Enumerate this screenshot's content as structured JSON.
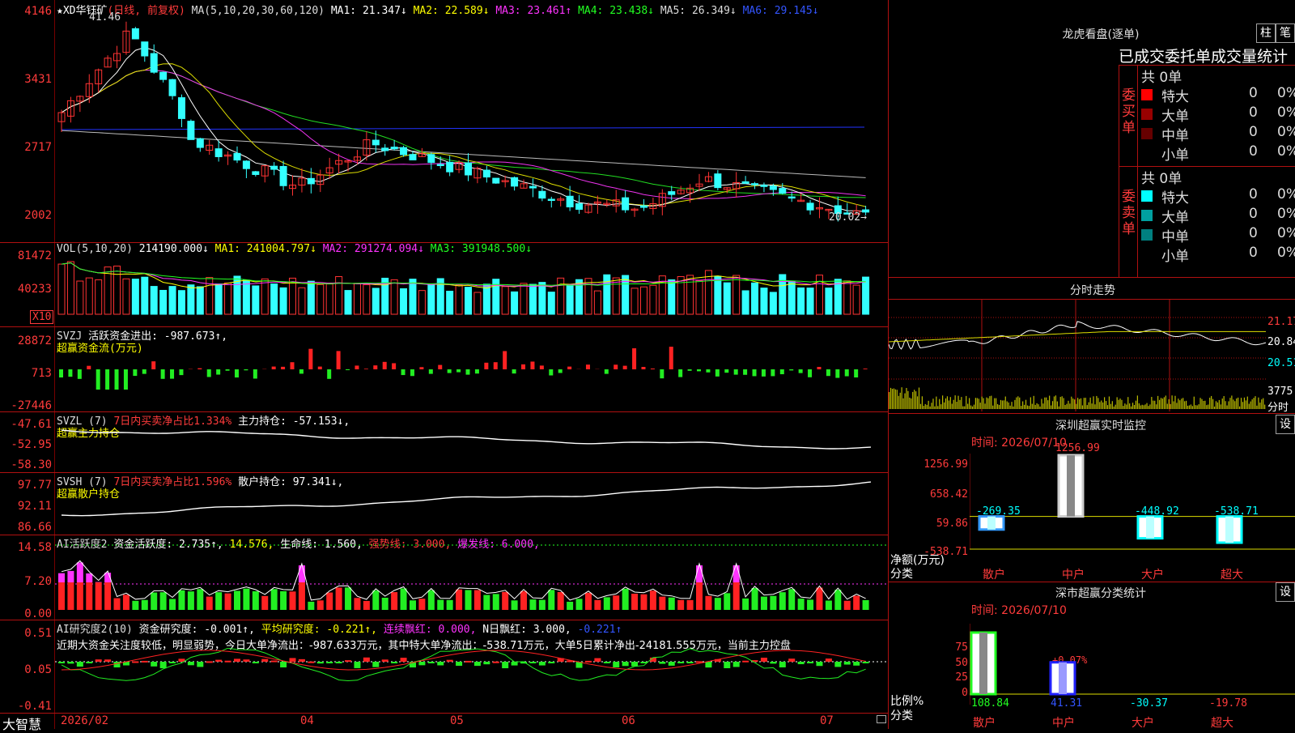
{
  "main_chart": {
    "stock_name": "★XD华钰矿",
    "period_tag": "(日线, 前复权)",
    "ma_header": "MA(5,10,20,30,60,120)",
    "ma1": "MA1: 21.347↓",
    "ma2": "MA2: 22.589↓",
    "ma3": "MA3: 23.461↑",
    "ma4": "MA4: 23.438↓",
    "ma5": "MA5: 26.349↓",
    "ma6": "MA6: 29.145↓",
    "high_label": "41.46",
    "low_label": "20.02→",
    "axis": [
      "4146",
      "3431",
      "2717",
      "2002"
    ]
  },
  "vol_panel": {
    "title": "VOL(5,10,20)",
    "value": "214190.000↓",
    "ma1": "MA1: 241004.797↓",
    "ma2": "MA2: 291274.094↓",
    "ma3": "MA3: 391948.500↓",
    "axis": [
      "81472",
      "40233"
    ],
    "unit": "X10"
  },
  "svzj_panel": {
    "title": "SVZJ",
    "line1": "活跃资金进出: -987.673↑,",
    "line2": "超赢资金流(万元)",
    "axis": [
      "28872",
      "713",
      "-27446"
    ]
  },
  "svzl_panel": {
    "title": "SVZL (7)",
    "ratio": "7日内买卖净占比1.334%",
    "main": "主力持仓: -57.153↓,",
    "line2": "超赢主力持仓",
    "axis": [
      "-47.61",
      "-52.95",
      "-58.30"
    ]
  },
  "svsh_panel": {
    "title": "SVSH (7)",
    "ratio": "7日内买卖净占比1.596%",
    "main": "散户持仓: 97.341↓,",
    "line2": "超赢散户持仓",
    "axis": [
      "97.77",
      "92.11",
      "86.66"
    ]
  },
  "ai_active": {
    "title": "AI活跃度2",
    "val1": "资金活跃度: 2.735↑,",
    "val2": "14.576,",
    "val3": "生命线: 1.560,",
    "val4": "强势线: 3.000,",
    "val5": "爆发线: 6.000,",
    "axis": [
      "14.58",
      "7.20",
      "0.00"
    ]
  },
  "ai_research": {
    "title": "AI研究度2(10)",
    "val1": "资金研究度: -0.001↑,",
    "val2": "平均研究度: -0.221↑,",
    "val3": "连续飘红: 0.000,",
    "val4": "N日飘红: 3.000,",
    "val5": "-0.221↑",
    "comment": "近期大资金关注度较低，明显弱势，今日大单净流出：-987.633万元，其中特大单净流出：-538.71万元，大单5日累计净出-24181.555万元，当前主力控盘",
    "axis": [
      "0.51",
      "0.05",
      "-0.41"
    ]
  },
  "bottom_axis": {
    "brand": "大智慧",
    "dates": [
      "2026/02",
      "04",
      "05",
      "06",
      "07"
    ]
  },
  "right_top": {
    "title": "龙虎看盘(逐单)",
    "btn1": "柱",
    "btn2": "笔",
    "subtitle": "已成交委托单成交量统计",
    "buy_label": "委买单",
    "sell_label": "委卖单",
    "buy_total": "共 0单",
    "sell_total": "共 0单",
    "buy_rows": [
      {
        "name": "特大",
        "count": "0",
        "pct": "0%",
        "color": "#ff0000"
      },
      {
        "name": "大单",
        "count": "0",
        "pct": "0%",
        "color": "#990000"
      },
      {
        "name": "中单",
        "count": "0",
        "pct": "0%",
        "color": "#660000"
      },
      {
        "name": "小单",
        "count": "0",
        "pct": "0%",
        "color": ""
      }
    ],
    "sell_rows": [
      {
        "name": "特大",
        "count": "0",
        "pct": "0%",
        "color": "#00ffff"
      },
      {
        "name": "大单",
        "count": "0",
        "pct": "0%",
        "color": "#00a0a0"
      },
      {
        "name": "中单",
        "count": "0",
        "pct": "0%",
        "color": "#008080"
      },
      {
        "name": "小单",
        "count": "0",
        "pct": "0%",
        "color": ""
      }
    ]
  },
  "intraday": {
    "title": "分时走势",
    "axis": [
      "21.17",
      "20.84",
      "20.51"
    ],
    "vol": "3775",
    "vol_unit": "分时"
  },
  "realtime_monitor": {
    "title": "深圳超赢实时监控",
    "btn": "设",
    "time_label": "时间: 2026/07/10",
    "axis": [
      "1256.99",
      "658.42",
      "59.86",
      "-538.71"
    ],
    "y_unit": "净额(万元)",
    "x_unit": "分类",
    "chart_data": {
      "type": "bar",
      "categories": [
        "散户",
        "中户",
        "大户",
        "超大"
      ],
      "values": [
        -269.35,
        1256.99,
        -448.92,
        -538.71
      ],
      "ylim": [
        -538.71,
        1256.99
      ]
    },
    "value_labels": [
      "-269.35",
      "1256.99",
      "-448.92",
      "-538.71"
    ]
  },
  "category_stats": {
    "title": "深市超赢分类统计",
    "btn": "设",
    "time_label": "时间: 2026/07/10",
    "axis": [
      "75",
      "50",
      "25",
      "0"
    ],
    "y_unit": "比例%",
    "x_unit": "分类",
    "chart_data": {
      "type": "bar",
      "categories": [
        "散户",
        "中户",
        "大户",
        "超大"
      ],
      "values": [
        108.84,
        41.31,
        -30.37,
        -19.78
      ],
      "ylim": [
        0,
        80
      ]
    },
    "value_labels": [
      "108.84",
      "41.31",
      "-30.37",
      "-19.78"
    ],
    "note": "+0.07%"
  }
}
